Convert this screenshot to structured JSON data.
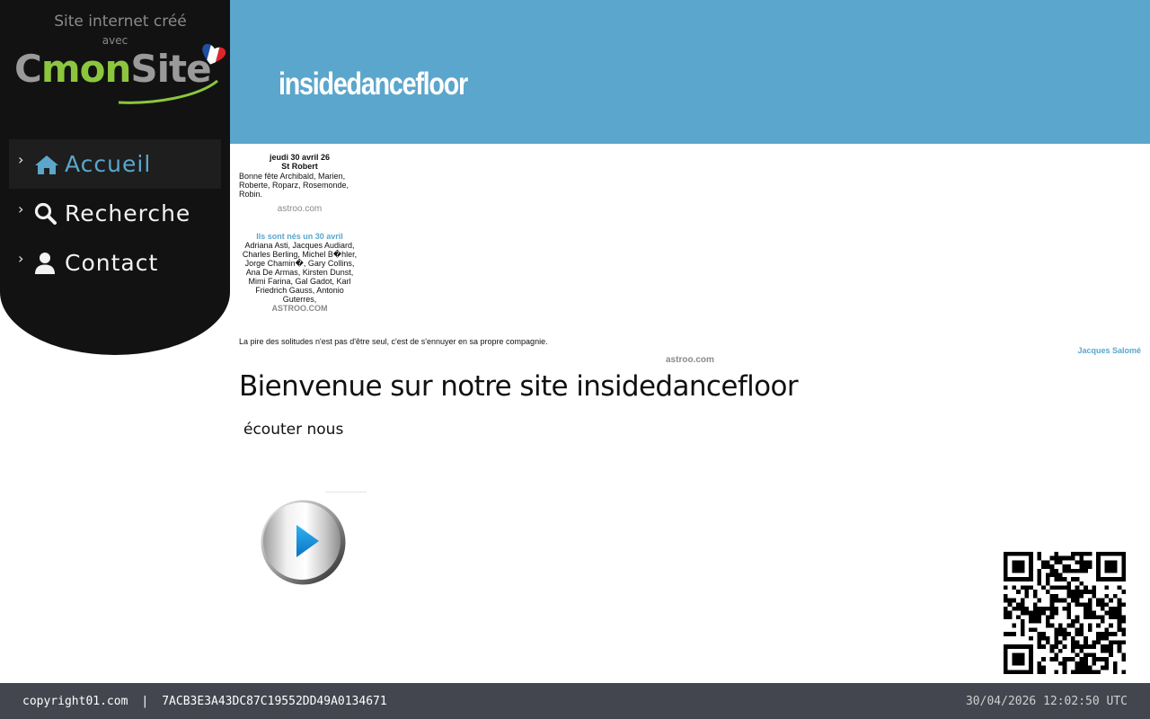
{
  "sidebar": {
    "brand_line1": "Site internet créé",
    "brand_line2": "avec",
    "logo": {
      "part1": "C",
      "part2": "mon",
      "part3": "Site"
    },
    "items": [
      {
        "label": "Accueil",
        "icon": "home-icon",
        "active": true
      },
      {
        "label": "Recherche",
        "icon": "search-icon",
        "active": false
      },
      {
        "label": "Contact",
        "icon": "user-icon",
        "active": false
      }
    ]
  },
  "header": {
    "title": "insidedancefloor"
  },
  "widgets": {
    "fete": {
      "date": "jeudi 30 avril 26",
      "saint": "St Robert",
      "text": "Bonne fête Archibald, Marien, Roberte, Roparz, Rosemonde, Robin.",
      "link": "astroo.com"
    },
    "births": {
      "title": "Ils sont nés un 30 avril",
      "names": "Adriana Asti, Jacques Audiard, Charles Berling, Michel B�hler, Jorge Chamin�, Gary Collins, Ana De Armas, Kirsten Dunst, Mimi Farina, Gal Gadot, Karl Friedrich Gauss, Antonio Guterres,",
      "link": "ASTROO.COM"
    },
    "quote": {
      "text": "La pire des solitudes n'est pas d'être seul, c'est de s'ennuyer en sa propre compagnie.",
      "author": "Jacques Salomé",
      "link": "astroo.com"
    }
  },
  "main": {
    "welcome": "Bienvenue sur notre site insidedancefloor",
    "listen": "écouter nous"
  },
  "footer": {
    "site": "copyright01.com",
    "separator": "|",
    "hash": "7ACB3E3A43DC87C19552DD49A0134671",
    "timestamp": "30/04/2026 12:02:50 UTC"
  },
  "colors": {
    "accent": "#5ba6cc",
    "sidebar": "#121212",
    "footer": "#43464f",
    "logo_green": "#8cc63f"
  }
}
